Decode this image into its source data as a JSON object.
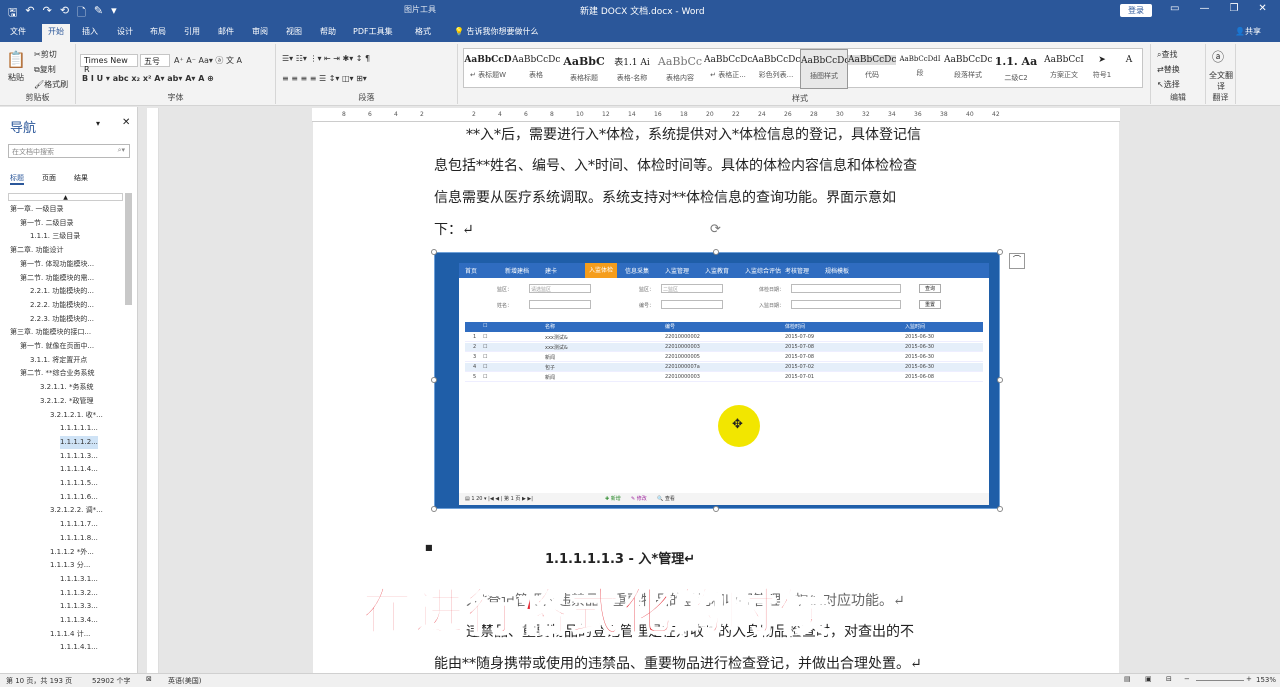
{
  "titlebar": {
    "qat": [
      "🖫",
      "↶",
      "↷",
      "⟲",
      "🗋",
      "✎",
      "▾"
    ],
    "context": "图片工具",
    "doc_title": "新建 DOCX 文档.docx - Word",
    "login": "登录",
    "winbtns": [
      "▭",
      "—",
      "❐",
      "✕"
    ]
  },
  "tabs": [
    "文件",
    "开始",
    "插入",
    "设计",
    "布局",
    "引用",
    "邮件",
    "审阅",
    "视图",
    "帮助",
    "PDF工具集",
    "格式"
  ],
  "tellme": "告诉我你想要做什么",
  "share": "共享",
  "ribbon": {
    "clipboard": {
      "paste": "粘贴",
      "cut": "剪切",
      "copy": "复制",
      "format_painter": "格式刷",
      "label": "剪贴板"
    },
    "font": {
      "name": "Times New R",
      "size": "五号",
      "label": "字体"
    },
    "paragraph": {
      "label": "段落"
    },
    "styles": {
      "label": "样式",
      "items": [
        {
          "sample": "AaBbCcD",
          "name": "↵ 表标题W"
        },
        {
          "sample": "AaBbCcDc",
          "name": "表格"
        },
        {
          "sample": "AaBbC",
          "name": "表格标题"
        },
        {
          "sample": "表1.1 Ai",
          "name": "表格-名称"
        },
        {
          "sample": "AaBbCc",
          "name": "表格内容"
        },
        {
          "sample": "AaBbCcDc",
          "name": "↵ 表格正..."
        },
        {
          "sample": "AaBbCcDc",
          "name": "彩色列表..."
        },
        {
          "sample": "AaBbCcDc",
          "name": "插图样式"
        },
        {
          "sample": "AaBbCcDc",
          "name": "代码"
        },
        {
          "sample": "AaBbCcDdI",
          "name": "段"
        },
        {
          "sample": "AaBbCcDc",
          "name": "段落样式"
        },
        {
          "sample": "1.1. Aa",
          "name": "二级C2"
        },
        {
          "sample": "AaBbCcI",
          "name": "方案正文"
        },
        {
          "sample": "➤",
          "name": "符号1"
        },
        {
          "sample": "A",
          "name": ""
        }
      ]
    },
    "editing": {
      "find": "查找",
      "replace": "替换",
      "select": "选择",
      "label": "编辑"
    },
    "translate": {
      "name": "全文翻译",
      "label": "翻译"
    }
  },
  "nav": {
    "title": "导航",
    "search_placeholder": "在文档中搜索",
    "tabs": [
      "标题",
      "页面",
      "结果"
    ],
    "items": [
      {
        "label": "第一章. 一级目录",
        "indent": 0
      },
      {
        "label": "第一节. 二级目录",
        "indent": 1
      },
      {
        "label": "1.1.1. 三级目录",
        "indent": 2
      },
      {
        "label": "第二章. 功能设计",
        "indent": 0
      },
      {
        "label": "第一节. 体现功能模块...",
        "indent": 1
      },
      {
        "label": "第二节. 功能模块的需...",
        "indent": 1
      },
      {
        "label": "2.2.1. 功能模块的...",
        "indent": 2
      },
      {
        "label": "2.2.2. 功能模块的...",
        "indent": 2
      },
      {
        "label": "2.2.3. 功能模块的...",
        "indent": 2
      },
      {
        "label": "第三章. 功能模块的接口...",
        "indent": 0
      },
      {
        "label": "第一节. 就像在页面中...",
        "indent": 1
      },
      {
        "label": "3.1.1. 将定置开点",
        "indent": 2
      },
      {
        "label": "第二节. **综合业务系统",
        "indent": 1
      },
      {
        "label": "3.2.1.1. *务系统",
        "indent": 3
      },
      {
        "label": "3.2.1.2. *政管理",
        "indent": 3
      },
      {
        "label": "3.2.1.2.1. 收*...",
        "indent": 4
      },
      {
        "label": "1.1.1.1.1...",
        "indent": 5
      },
      {
        "label": "1.1.1.1.2...",
        "indent": 5
      },
      {
        "label": "1.1.1.1.3...",
        "indent": 5
      },
      {
        "label": "1.1.1.1.4...",
        "indent": 5
      },
      {
        "label": "1.1.1.1.5...",
        "indent": 5
      },
      {
        "label": "1.1.1.1.6...",
        "indent": 5
      },
      {
        "label": "3.2.1.2.2. 调*...",
        "indent": 4
      },
      {
        "label": "1.1.1.1.7...",
        "indent": 5
      },
      {
        "label": "1.1.1.1.8...",
        "indent": 5
      },
      {
        "label": "1.1.1.2 *外...",
        "indent": 4
      },
      {
        "label": "1.1.1.3 分...",
        "indent": 4
      },
      {
        "label": "1.1.1.3.1...",
        "indent": 5
      },
      {
        "label": "1.1.1.3.2...",
        "indent": 5
      },
      {
        "label": "1.1.1.3.3...",
        "indent": 5
      },
      {
        "label": "1.1.1.3.4...",
        "indent": 5
      },
      {
        "label": "1.1.1.4 计...",
        "indent": 4
      },
      {
        "label": "1.1.1.4.1...",
        "indent": 5
      }
    ]
  },
  "ruler": [
    "8",
    "6",
    "4",
    "2",
    "",
    "2",
    "4",
    "6",
    "8",
    "10",
    "12",
    "14",
    "16",
    "18",
    "20",
    "22",
    "24",
    "26",
    "28",
    "30",
    "32",
    "34",
    "36",
    "38",
    "40",
    "42"
  ],
  "doc": {
    "lines": [
      "**入*后，需要进行入*体检，系统提供对入*体检信息的登记，具体登记信",
      "息包括**姓名、编号、入*时间、体检时间等。具体的体检内容信息和体检检查",
      "信息需要从医疗系统调取。系统支持对**体检信息的查询功能。界面示意如",
      "下：↵"
    ],
    "heading": "1.1.1.1.1.3 - 入*管理↵",
    "bottom_lines": [
      "入*登记管理对违禁品，重要物品的登记和收押管理，提供对应功能。↵",
      "违禁品、重要物品的登记管理是在对收**的入身物品检查时，对查出的不",
      "能由**随身携带或使用的违禁品、重要物品进行检查登记，并做出合理处置。↵"
    ],
    "overlay": "在进行格式化的时候"
  },
  "screenshot": {
    "nav": [
      "首页",
      "新增建档",
      "建卡",
      "入监体检",
      "信息采集",
      "入监管理",
      "入监教育",
      "入监综合评估",
      "考核管理",
      "规档模板"
    ],
    "active": "入监体检",
    "filters": {
      "label1": "监区：",
      "val1": "请选监区",
      "label2": "监区：",
      "val2": "二监区",
      "label3": "体检日期：",
      "label4": "姓名：",
      "label5": "编号：",
      "label6": "入监日期：",
      "query": "查询",
      "reset": "重置"
    },
    "headers": [
      "",
      "名称",
      "编号",
      "体检时间",
      "入监时间"
    ],
    "rows": [
      {
        "n": "1",
        "name": "xxx测试&",
        "id": "22010000002",
        "t1": "2015-07-09",
        "t2": "2015-06-30"
      },
      {
        "n": "2",
        "name": "xxx测试&",
        "id": "22010000003",
        "t1": "2015-07-08",
        "t2": "2015-06-30"
      },
      {
        "n": "3",
        "name": "新闻",
        "id": "22010000005",
        "t1": "2015-07-08",
        "t2": "2015-06-30"
      },
      {
        "n": "4",
        "name": "包子",
        "id": "2201000007a",
        "t1": "2015-07-02",
        "t2": "2015-06-30"
      },
      {
        "n": "5",
        "name": "新闻",
        "id": "22010000003",
        "t1": "2015-07-01",
        "t2": "2015-06-08"
      }
    ],
    "footer": {
      "per_page": "20",
      "page": "1",
      "add": "新增",
      "edit": "修改",
      "view": "查看"
    }
  },
  "status": {
    "page": "第 10 页，共 193 页",
    "words": "52902 个字",
    "lang": "英语(美国)",
    "zoom": "153%"
  }
}
